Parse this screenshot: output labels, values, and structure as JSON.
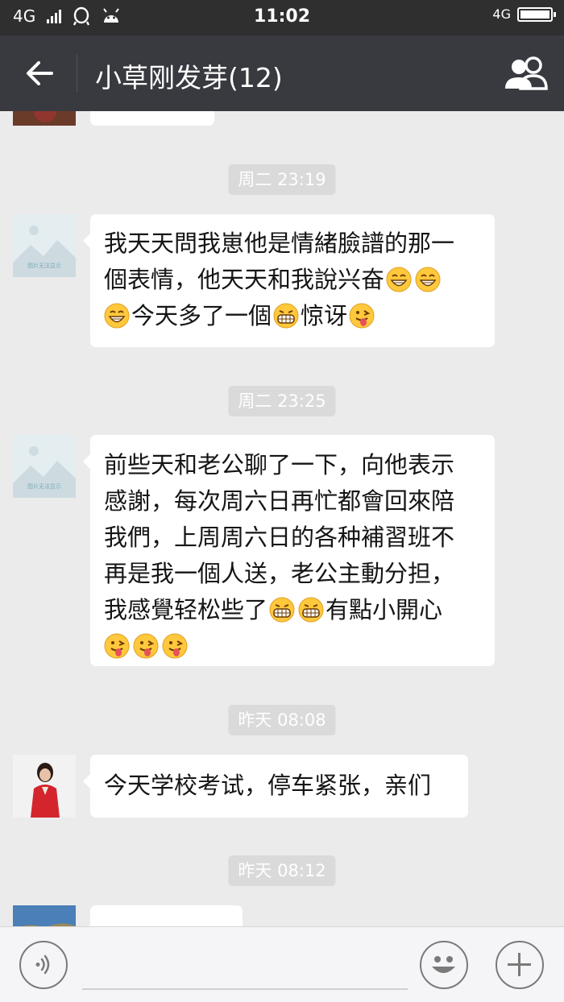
{
  "status_bar": {
    "network_left": "4G",
    "time": "11:02",
    "network_right": "4G"
  },
  "header": {
    "title": "小草刚发芽(12)"
  },
  "messages": [
    {
      "time": "周二 23:19"
    },
    {
      "lines": [
        "我天天問我崽他是情緒臉譜的那一",
        "個表情，他天天和我說兴奋",
        "今天多了一個",
        "惊讶"
      ]
    },
    {
      "time": "周二 23:25"
    },
    {
      "lines": [
        "前些天和老公聊了一下，向他表示",
        "感謝，每次周六日再忙都會回來陪",
        "我們，上周周六日的各种補習班不",
        "再是我一個人送，老公主動分担，",
        "我感覺轻松些了",
        "有點小開心"
      ]
    },
    {
      "time": "昨天 08:08"
    },
    {
      "lines": [
        "今天学校考试，停车紧张，亲们"
      ]
    },
    {
      "time": "昨天 08:12"
    }
  ],
  "avatar_placeholder_text": "图片无法显示"
}
